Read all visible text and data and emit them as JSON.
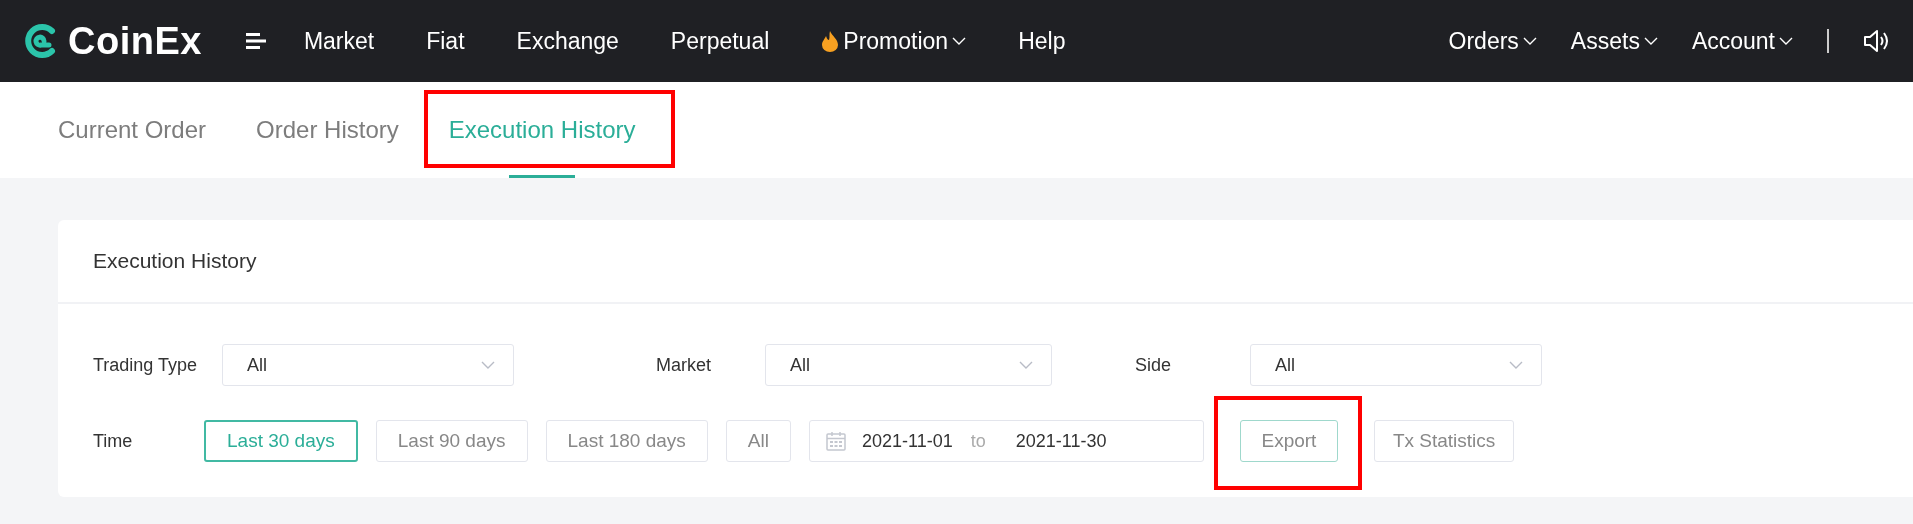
{
  "navbar": {
    "logo": "CoinEx",
    "menu": [
      {
        "label": "Market",
        "kind": "link"
      },
      {
        "label": "Fiat",
        "kind": "link"
      },
      {
        "label": "Exchange",
        "kind": "link"
      },
      {
        "label": "Perpetual",
        "kind": "link"
      },
      {
        "label": "Promotion",
        "kind": "promo"
      },
      {
        "label": "Help",
        "kind": "link"
      }
    ],
    "right_menu": [
      {
        "label": "Orders",
        "kind": "dropdown"
      },
      {
        "label": "Assets",
        "kind": "dropdown"
      },
      {
        "label": "Account",
        "kind": "dropdown"
      }
    ]
  },
  "tabs": [
    {
      "label": "Current Order",
      "selected": false,
      "highlighted": false
    },
    {
      "label": "Order History",
      "selected": false,
      "highlighted": false
    },
    {
      "label": "Execution History",
      "selected": true,
      "highlighted": true
    }
  ],
  "card": {
    "title": "Execution History",
    "filters": [
      {
        "label": "Trading Type",
        "value": "All"
      },
      {
        "label": "Market",
        "value": "All"
      },
      {
        "label": "Side",
        "value": "All"
      }
    ],
    "time": {
      "label": "Time",
      "ranges": [
        {
          "label": "Last 30 days",
          "selected": true
        },
        {
          "label": "Last 90 days",
          "selected": false
        },
        {
          "label": "Last 180 days",
          "selected": false
        },
        {
          "label": "All",
          "selected": false
        }
      ],
      "date_from": "2021-11-01",
      "separator": "to",
      "date_to": "2021-11-30"
    },
    "actions": [
      {
        "label": "Export",
        "highlighted": true
      },
      {
        "label": "Tx Statistics",
        "highlighted": false
      }
    ]
  }
}
